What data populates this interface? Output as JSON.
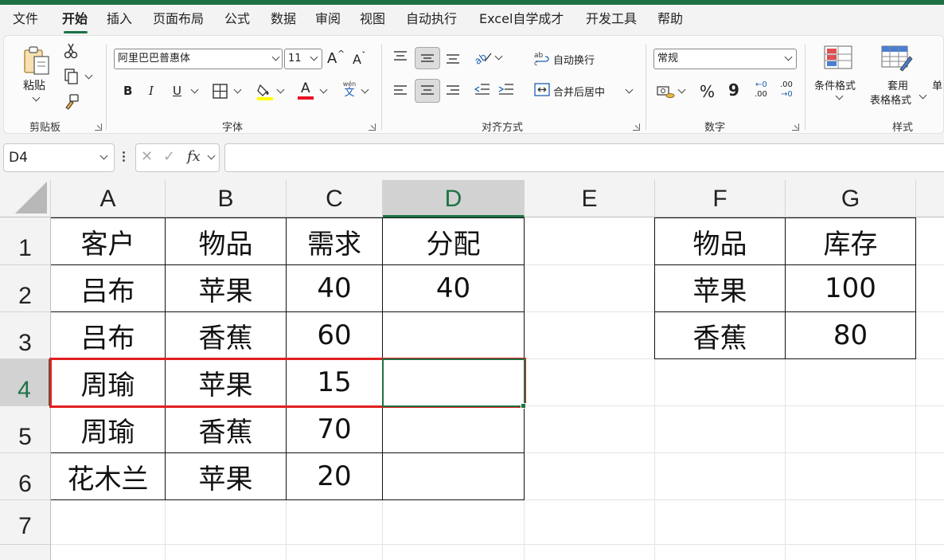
{
  "tabs": [
    "文件",
    "开始",
    "插入",
    "页面布局",
    "公式",
    "数据",
    "审阅",
    "视图",
    "自动执行",
    "Excel自学成才",
    "开发工具",
    "帮助"
  ],
  "active_tab": "开始",
  "ribbon": {
    "clipboard": {
      "paste_label": "粘贴",
      "group_label": "剪贴板"
    },
    "font": {
      "font_name": "阿里巴巴普惠体",
      "font_size": "11",
      "group_label": "字体",
      "grow_label": "A",
      "shrink_label": "A",
      "bold_label": "B",
      "italic_label": "I",
      "underline_label": "U",
      "font_color_label": "A",
      "phonetic_label": "wén",
      "phonetic_char": "文"
    },
    "alignment": {
      "wrap_text_label": "自动换行",
      "merge_center_label": "合并后居中",
      "group_label": "对齐方式"
    },
    "number": {
      "format": "常规",
      "group_label": "数字",
      "percent_label": "%",
      "comma_label": "9",
      "inc_decimal_label": ".00",
      "dec_decimal_label": ".00"
    },
    "styles": {
      "conditional_format_label": "条件格式",
      "table_format_label_1": "套用",
      "table_format_label_2": "表格格式",
      "cell_styles_partial": "单",
      "group_label": "样式"
    },
    "colors": {
      "highlight": "#ffff00",
      "font_color": "#e81123",
      "accent": "#1e7145"
    }
  },
  "formula_bar": {
    "name_box": "D4",
    "cancel_symbol": "✕",
    "enter_symbol": "✓",
    "fx_label": "fx",
    "formula": ""
  },
  "sheet": {
    "columns": [
      "A",
      "B",
      "C",
      "D",
      "E",
      "F",
      "G"
    ],
    "rows": [
      "1",
      "2",
      "3",
      "4",
      "5",
      "6",
      "7"
    ],
    "selected_cell": "D4",
    "table1": {
      "headers": [
        "客户",
        "物品",
        "需求",
        "分配"
      ],
      "rows": [
        [
          "吕布",
          "苹果",
          "40",
          "40"
        ],
        [
          "吕布",
          "香蕉",
          "60",
          ""
        ],
        [
          "周瑜",
          "苹果",
          "15",
          ""
        ],
        [
          "周瑜",
          "香蕉",
          "70",
          ""
        ],
        [
          "花木兰",
          "苹果",
          "20",
          ""
        ]
      ]
    },
    "table2": {
      "headers": [
        "物品",
        "库存"
      ],
      "rows": [
        [
          "苹果",
          "100"
        ],
        [
          "香蕉",
          "80"
        ]
      ]
    }
  }
}
